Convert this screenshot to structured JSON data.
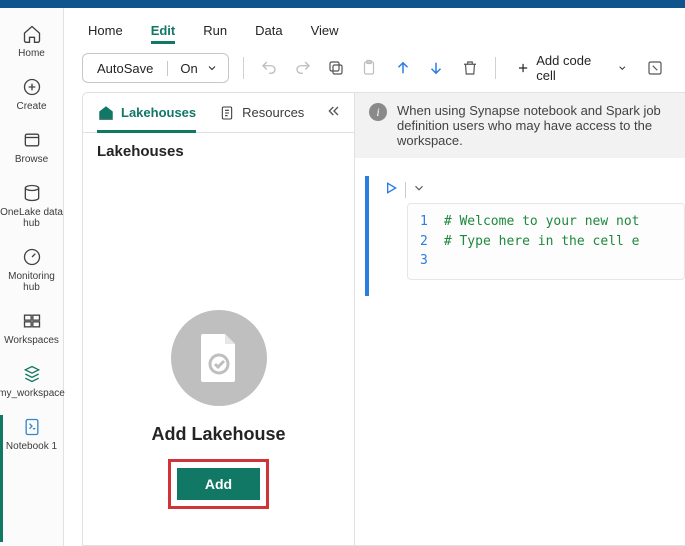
{
  "rail": {
    "home": "Home",
    "create": "Create",
    "browse": "Browse",
    "onelake": "OneLake data hub",
    "monitoring": "Monitoring hub",
    "workspaces": "Workspaces",
    "myws": "my_workspace",
    "notebook": "Notebook 1"
  },
  "menu": {
    "home": "Home",
    "edit": "Edit",
    "run": "Run",
    "data": "Data",
    "view": "View"
  },
  "toolbar": {
    "autosave": "AutoSave",
    "autosave_state": "On",
    "addcode": "Add code cell"
  },
  "panel": {
    "tab_lakehouses": "Lakehouses",
    "tab_resources": "Resources",
    "heading": "Lakehouses",
    "placeholder_title": "Add Lakehouse",
    "add_btn": "Add"
  },
  "banner": {
    "text": "When using Synapse notebook and Spark job definition users who may have access to the workspace."
  },
  "code": {
    "l1": "1",
    "l2": "2",
    "l3": "3",
    "c1": "# Welcome to your new not",
    "c2": "# Type here in the cell e",
    "c3": ""
  }
}
